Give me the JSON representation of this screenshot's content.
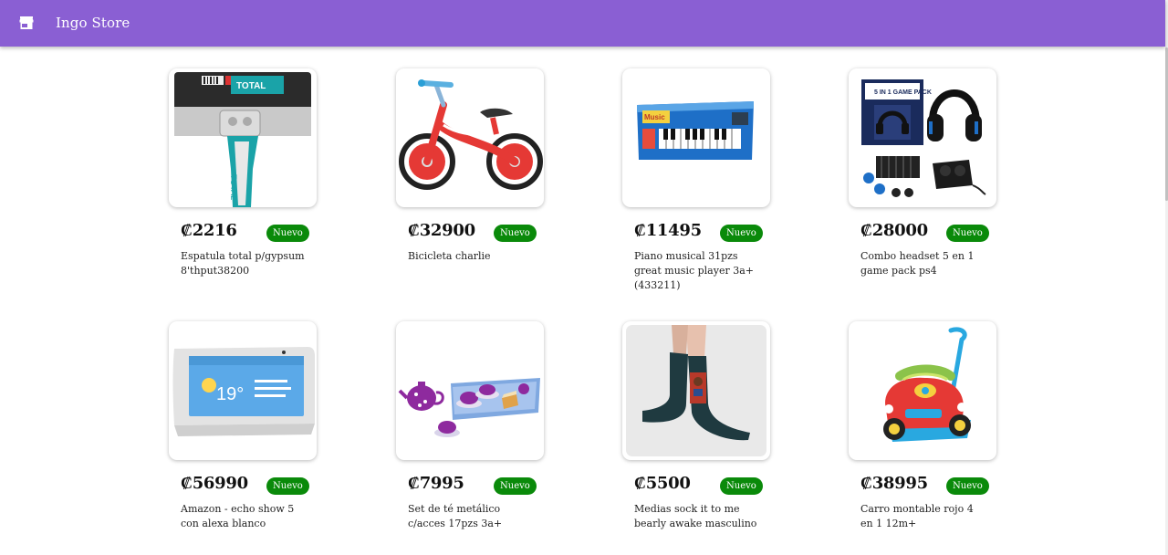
{
  "appbar": {
    "title": "Ingo Store",
    "icon": "store-icon",
    "color": "#8a5fd3"
  },
  "badge_color": "#0a8a0a",
  "products": [
    {
      "price": "₡2216",
      "badge": "Nuevo",
      "name": "Espatula total p/gypsum 8'thput38200",
      "icon": "spatula-image"
    },
    {
      "price": "₡32900",
      "badge": "Nuevo",
      "name": "Bicicleta charlie",
      "icon": "bicycle-image"
    },
    {
      "price": "₡11495",
      "badge": "Nuevo",
      "name": "Piano musical 31pzs great music player 3a+(433211)",
      "icon": "piano-image"
    },
    {
      "price": "₡28000",
      "badge": "Nuevo",
      "name": "Combo headset 5 en 1 game pack ps4",
      "icon": "headset-image"
    },
    {
      "price": "₡56990",
      "badge": "Nuevo",
      "name": "Amazon - echo show 5 con alexa blanco",
      "icon": "echo-show-image"
    },
    {
      "price": "₡7995",
      "badge": "Nuevo",
      "name": "Set de té metálico c/acces 17pzs 3a+",
      "icon": "tea-set-image"
    },
    {
      "price": "₡5500",
      "badge": "Nuevo",
      "name": "Medias sock it to me bearly awake masculino",
      "icon": "socks-image"
    },
    {
      "price": "₡38995",
      "badge": "Nuevo",
      "name": "Carro montable rojo 4 en 1 12m+",
      "icon": "ride-on-car-image"
    }
  ],
  "echo_display": {
    "temp": "19°"
  }
}
